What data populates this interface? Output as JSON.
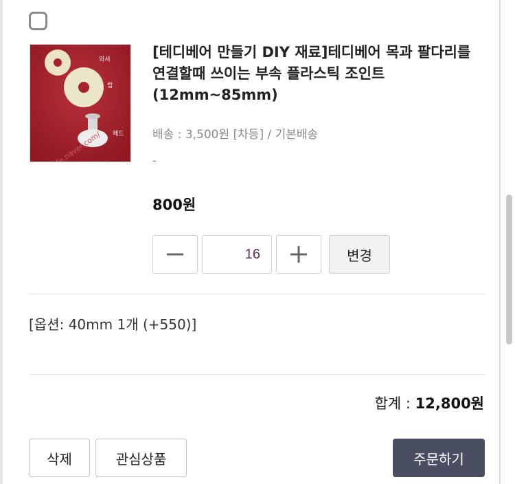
{
  "item": {
    "title": "[테디베어 만들기 DIY 재료]테디베어 목과 팔다리를 연결할때 쓰이는 부속 플라스틱 조인트 (12mm~85mm)",
    "shipping": "배송 : 3,500원 [차등] / 기본배송",
    "dash": "-",
    "price": "800원",
    "image_labels": [
      "와셔",
      "링",
      "헤드"
    ]
  },
  "quantity": {
    "value": "16",
    "minus_label": "−",
    "plus_label": "+",
    "change_label": "변경"
  },
  "option": {
    "text": "[옵션: 40mm 1개 (+550)]"
  },
  "summary": {
    "total_label": "합계 : ",
    "total_value": "12,800원"
  },
  "actions": {
    "delete_label": "삭제",
    "wishlist_label": "관심상품",
    "order_label": "주문하기"
  },
  "colors": {
    "order_button_bg": "#4a4e62",
    "thumbnail_bg": "#a8222c"
  }
}
